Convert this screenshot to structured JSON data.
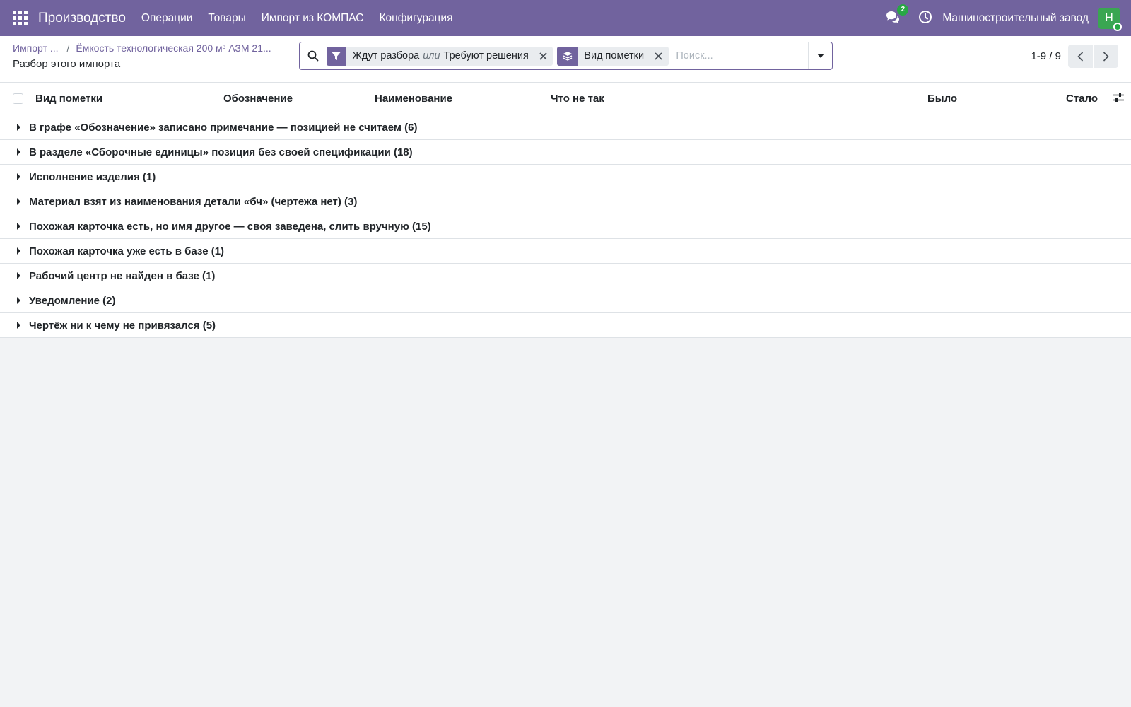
{
  "navbar": {
    "app_name": "Производство",
    "menu": [
      "Операции",
      "Товары",
      "Импорт из КОМПАС",
      "Конфигурация"
    ],
    "chat_count": "2",
    "company": "Машиностроительный завод",
    "avatar_letter": "Н",
    "colors": {
      "navbar_bg": "#71639e",
      "avatar_bg": "#3aa652",
      "badge": "#28a745"
    }
  },
  "breadcrumb": {
    "items": [
      "Импорт ...",
      "Ёмкость технологическая 200 м³ АЗМ 21..."
    ],
    "separator": "/",
    "current": "Разбор этого импорта"
  },
  "search": {
    "facets": [
      {
        "icon": "filter-icon",
        "values": [
          "Ждут разбора",
          "Требуют решения"
        ],
        "or_label": "или"
      },
      {
        "icon": "layers-icon",
        "values": [
          "Вид пометки"
        ]
      }
    ],
    "placeholder": "Поиск..."
  },
  "pager": {
    "value": "1-9 / 9"
  },
  "list": {
    "columns": [
      "Вид пометки",
      "Обозначение",
      "Наименование",
      "Что не так",
      "Было",
      "Стало"
    ],
    "groups": [
      "В графе «Обозначение» записано примечание — позицией не считаем (6)",
      "В разделе «Сборочные единицы» позиция без своей спецификации (18)",
      "Исполнение изделия (1)",
      "Материал взят из наименования детали «бч» (чертежа нет) (3)",
      "Похожая карточка есть, но имя другое — своя заведена, слить вручную (15)",
      "Похожая карточка уже есть в базе (1)",
      "Рабочий центр не найден в базе (1)",
      "Уведомление (2)",
      "Чертёж ни к чему не привязался (5)"
    ]
  }
}
